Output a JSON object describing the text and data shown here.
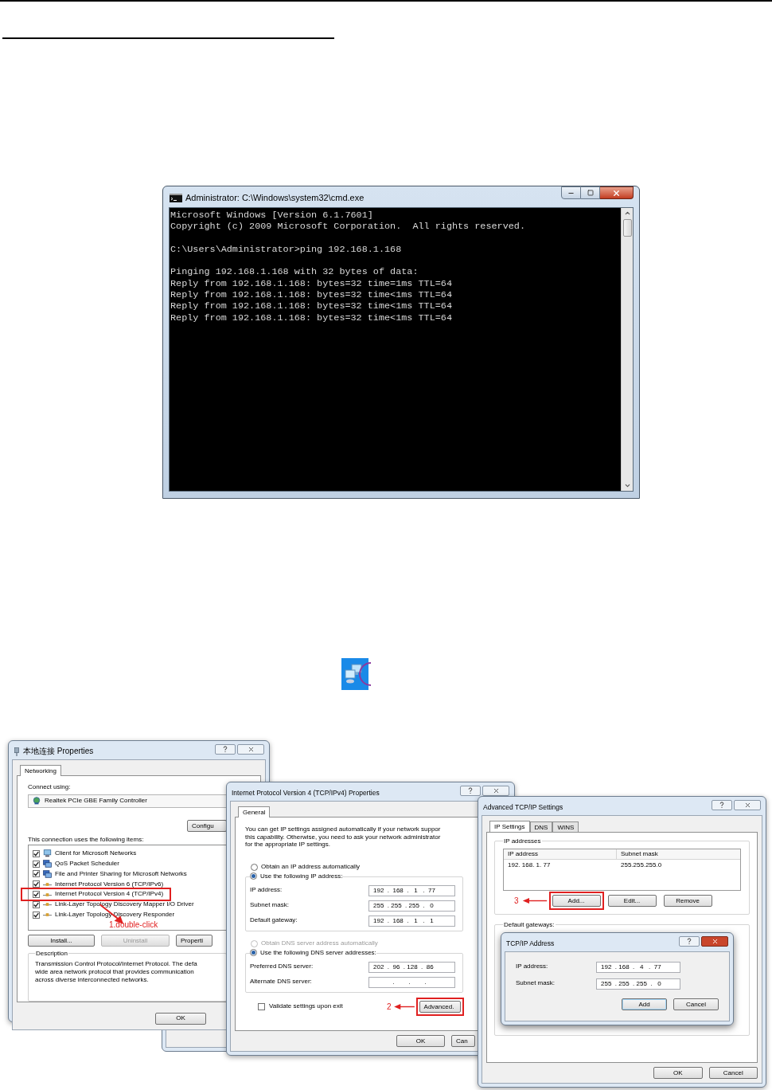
{
  "cmd_window": {
    "title": "Administrator: C:\\Windows\\system32\\cmd.exe",
    "blocks": [
      [
        "Microsoft Windows [Version 6.1.7601]",
        "Copyright (c) 2009 Microsoft Corporation.  All rights reserved."
      ],
      [
        "C:\\Users\\Administrator>ping 192.168.1.168"
      ],
      [
        "Pinging 192.168.1.168 with 32 bytes of data:",
        "Reply from 192.168.1.168: bytes=32 time=1ms TTL=64",
        "Reply from 192.168.1.168: bytes=32 time<1ms TTL=64",
        "Reply from 192.168.1.168: bytes=32 time<1ms TTL=64",
        "Reply from 192.168.1.168: bytes=32 time<1ms TTL=64"
      ]
    ]
  },
  "properties_dialog": {
    "title": "本地连接 Properties",
    "tabs": [
      {
        "label": "Networking",
        "selected": true
      }
    ],
    "connect_label": "Connect using:",
    "adapter": "Realtek PCIe GBE Family Controller",
    "configure_button": "Configu",
    "items_label": "This connection uses the following items:",
    "items": [
      {
        "label": "Client for Microsoft Networks",
        "checked": true,
        "highlighted": false,
        "kind": "client"
      },
      {
        "label": "QoS Packet Scheduler",
        "checked": true,
        "highlighted": false,
        "kind": "service"
      },
      {
        "label": "File and Printer Sharing for Microsoft Networks",
        "checked": true,
        "highlighted": false,
        "kind": "service"
      },
      {
        "label": "Internet Protocol Version 6 (TCP/IPv6)",
        "checked": true,
        "highlighted": false,
        "kind": "protocol"
      },
      {
        "label": "Internet Protocol Version 4 (TCP/IPv4)",
        "checked": true,
        "highlighted": true,
        "kind": "protocol"
      },
      {
        "label": "Link-Layer Topology Discovery Mapper I/O Driver",
        "checked": true,
        "highlighted": false,
        "kind": "protocol"
      },
      {
        "label": "Link-Layer Topology Discovery Responder",
        "checked": true,
        "highlighted": false,
        "kind": "protocol"
      }
    ],
    "annotation": "1.double-click",
    "buttons": [
      {
        "label": "Install...",
        "disabled": false
      },
      {
        "label": "Uninstall",
        "disabled": true
      },
      {
        "label": "Properti",
        "disabled": false
      }
    ],
    "description_label": "Description",
    "description_lines": [
      "Transmission Control Protocol/Internet Protocol. The defa",
      "wide area network protocol that provides communication",
      "across diverse interconnected networks."
    ],
    "ok_button": "OK"
  },
  "ipv4_dialog": {
    "title": "Internet Protocol Version 4 (TCP/IPv4) Properties",
    "tabs": [
      {
        "label": "General",
        "selected": true
      }
    ],
    "intro_lines": [
      "You can get IP settings assigned automatically if your network suppor",
      "this capability. Otherwise, you need to ask your network administrator",
      "for the appropriate IP settings."
    ],
    "ip_options": [
      {
        "label": "Obtain an IP address automatically",
        "selected": false,
        "disabled": false
      },
      {
        "label": "Use the following IP address:",
        "selected": true,
        "disabled": false
      }
    ],
    "ip_fields": [
      {
        "label": "IP address:",
        "value": "192  .  168  .   1   .  77"
      },
      {
        "label": "Subnet mask:",
        "value": "255  . 255  . 255  .   0"
      },
      {
        "label": "Default gateway:",
        "value": "192  .  168  .   1   .   1"
      }
    ],
    "dns_options": [
      {
        "label": "Obtain DNS server address automatically",
        "selected": false,
        "disabled": true
      },
      {
        "label": "Use the following DNS server addresses:",
        "selected": true,
        "disabled": false
      }
    ],
    "dns_fields": [
      {
        "label": "Preferred DNS server:",
        "value": "202  .  96  . 128  .  86"
      },
      {
        "label": "Alternate DNS server:",
        "value": "           .        .        ."
      }
    ],
    "validate": {
      "label": "Validate settings upon exit",
      "checked": false
    },
    "annotation": "2",
    "advanced_button": {
      "label": "Advanced.",
      "highlighted": true
    },
    "buttons": [
      "OK",
      "Can"
    ]
  },
  "advanced_dialog": {
    "title": "Advanced TCP/IP Settings",
    "tabs": [
      {
        "label": "IP Settings",
        "selected": true
      },
      {
        "label": "DNS",
        "selected": false
      },
      {
        "label": "WINS",
        "selected": false
      }
    ],
    "ip_group_label": "IP addresses",
    "table": {
      "columns": [
        "IP address",
        "Subnet mask"
      ],
      "rows": [
        [
          "192. 168. 1. 77",
          "255.255.255.0"
        ]
      ]
    },
    "annotation": "3",
    "ip_buttons": [
      {
        "label": "Add...",
        "highlighted": true
      },
      {
        "label": "Edit...",
        "highlighted": false
      },
      {
        "label": "Remove",
        "highlighted": false
      }
    ],
    "gateway_group_label": "Default gateways:",
    "buttons": [
      "OK",
      "Cancel"
    ]
  },
  "address_dialog": {
    "title": "TCP/IP Address",
    "fields": [
      {
        "label": "IP address:",
        "value": "192  . 168  .   4   .  77"
      },
      {
        "label": "Subnet mask:",
        "value": "255  . 255  . 255  .   0"
      }
    ],
    "buttons": [
      {
        "label": "Add",
        "default": true
      },
      {
        "label": "Cancel",
        "default": false
      }
    ]
  }
}
